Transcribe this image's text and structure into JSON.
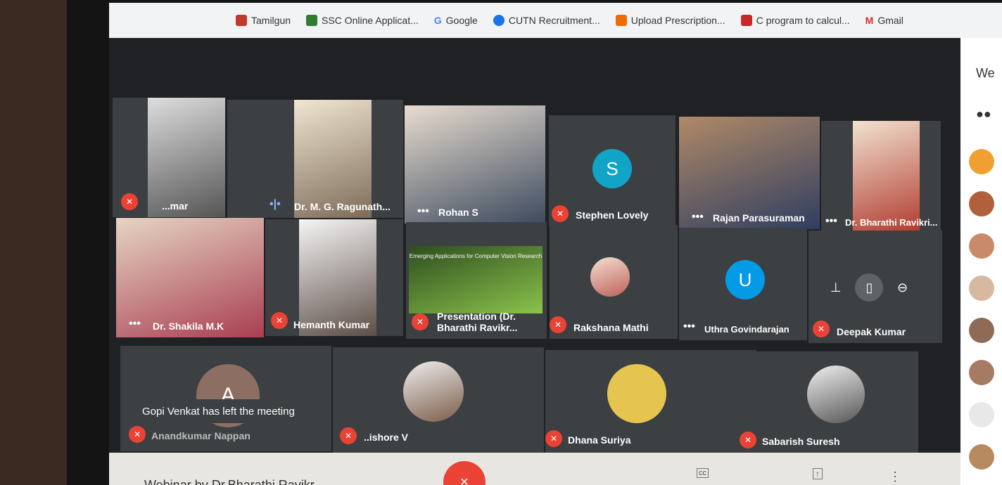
{
  "bookmarks": [
    {
      "label": "Tamilgun",
      "icon": "tamilgun-icon",
      "color": "#c0392b"
    },
    {
      "label": "SSC Online Applicat...",
      "icon": "ssc-icon",
      "color": "#2e7d32"
    },
    {
      "label": "Google",
      "icon": "google-icon",
      "color": "#4285f4"
    },
    {
      "label": "CUTN Recruitment...",
      "icon": "check-icon",
      "color": "#1a73e8"
    },
    {
      "label": "Upload Prescription...",
      "icon": "upload-icon",
      "color": "#ef6c00"
    },
    {
      "label": "C program to calcul...",
      "icon": "c-icon",
      "color": "#c62828"
    },
    {
      "label": "Gmail",
      "icon": "gmail-icon",
      "color": "#d93025"
    }
  ],
  "participants": [
    {
      "name": "...mar",
      "muted": true
    },
    {
      "name": "Dr. M. G. Ragunath...",
      "muted": false,
      "speaking": true
    },
    {
      "name": "Rohan S",
      "muted": false
    },
    {
      "name": "Stephen Lovely",
      "muted": true,
      "initial": "S",
      "color": "#12a4c7"
    },
    {
      "name": "Rajan Parasuraman",
      "muted": false
    },
    {
      "name": "Dr. Bharathi Ravikri...",
      "muted": false
    },
    {
      "name": "Dr. Shakila M.K",
      "muted": false
    },
    {
      "name": "Hemanth Kumar",
      "muted": true
    },
    {
      "name": "Presentation (Dr. Bharathi Ravikr...",
      "muted": true
    },
    {
      "name": "Rakshana Mathi",
      "muted": true
    },
    {
      "name": "Uthra Govindarajan",
      "muted": false,
      "initial": "U",
      "color": "#039be5"
    },
    {
      "name": "Deepak Kumar",
      "muted": true
    },
    {
      "name": "Anandkumar Nappan",
      "muted": true,
      "initial": "A",
      "color": "#8d6e63"
    },
    {
      "name": "..ishore V",
      "muted": true
    },
    {
      "name": "Dhana Suriya",
      "muted": true
    },
    {
      "name": "Sabarish Suresh",
      "muted": true
    }
  ],
  "toast": "Gopi Venkat has left the meeting",
  "meeting_title": "Webinar by Dr.Bharathi Ravikr...",
  "side_header": "We",
  "presentation_slide_text": "Emerging Applications for Computer Vision Research"
}
